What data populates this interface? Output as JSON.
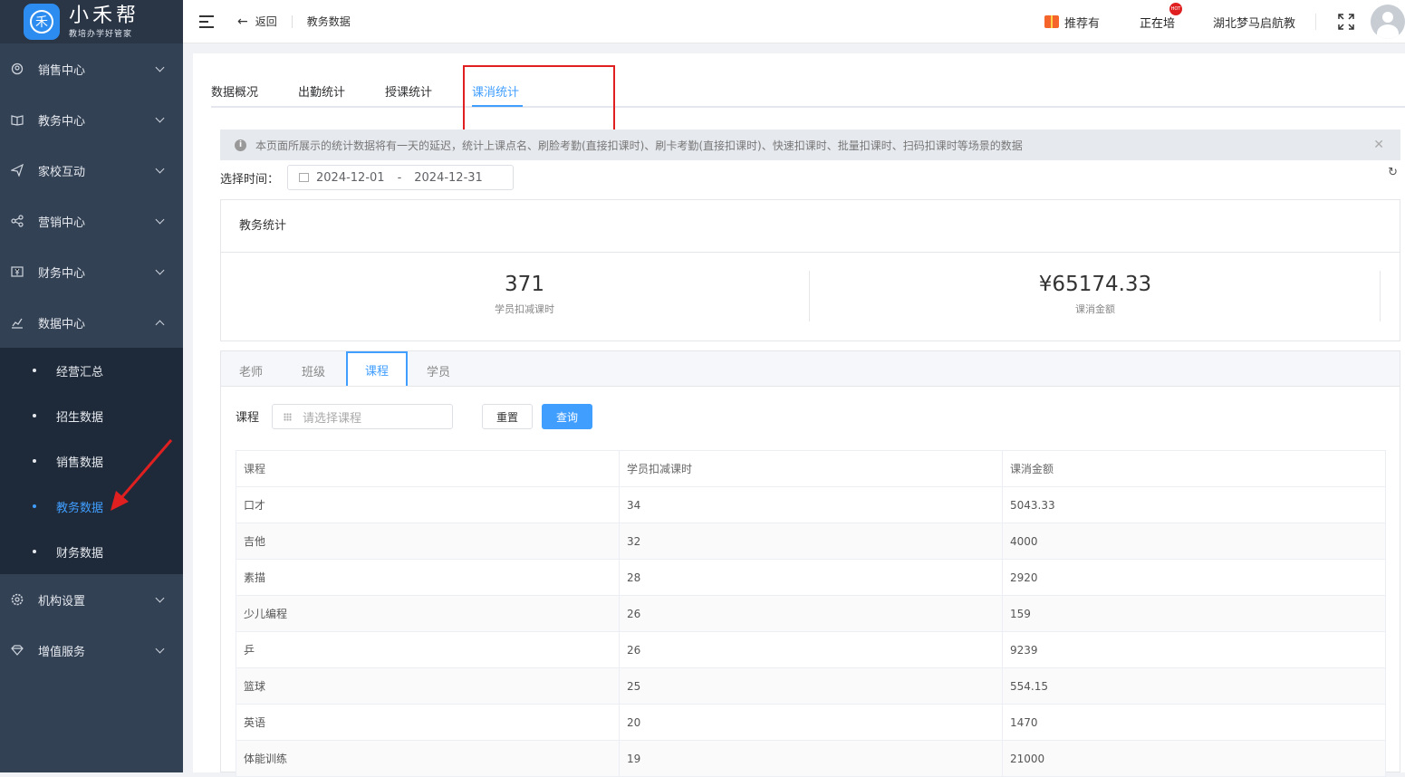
{
  "brand": {
    "name": "小禾帮",
    "slogan": "教培办学好管家",
    "icon_glyph": "禾"
  },
  "sidebar": {
    "items": [
      {
        "label": "销售中心"
      },
      {
        "label": "教务中心"
      },
      {
        "label": "家校互动"
      },
      {
        "label": "营销中心"
      },
      {
        "label": "财务中心"
      },
      {
        "label": "数据中心"
      }
    ],
    "data_sub": [
      {
        "label": "经营汇总"
      },
      {
        "label": "招生数据"
      },
      {
        "label": "销售数据"
      },
      {
        "label": "教务数据"
      },
      {
        "label": "财务数据"
      }
    ],
    "bottom_items": [
      {
        "label": "机构设置"
      },
      {
        "label": "增值服务"
      }
    ]
  },
  "header": {
    "back": "返回",
    "crumb": "教务数据",
    "recommend": "推荐有",
    "hiring": "正在培",
    "hot_badge": "HOT",
    "org": "湖北梦马启航教"
  },
  "tabs": [
    {
      "label": "数据概况"
    },
    {
      "label": "出勤统计"
    },
    {
      "label": "授课统计"
    },
    {
      "label": "课消统计"
    }
  ],
  "notice": "本页面所展示的统计数据将有一天的延迟，统计上课点名、刷脸考勤(直接扣课时)、刷卡考勤(直接扣课时)、快速扣课时、批量扣课时、扫码扣课时等场景的数据",
  "date": {
    "label": "选择时间：",
    "start": "2024-12-01",
    "sep": "-",
    "end": "2024-12-31"
  },
  "stats": {
    "title": "教务统计",
    "hours": {
      "value": "371",
      "label": "学员扣减课时"
    },
    "amount": {
      "value": "¥65174.33",
      "label": "课消金额"
    }
  },
  "sub_tabs": [
    {
      "label": "老师"
    },
    {
      "label": "班级"
    },
    {
      "label": "课程"
    },
    {
      "label": "学员"
    }
  ],
  "filter": {
    "label": "课程",
    "placeholder": "请选择课程",
    "reset": "重置",
    "query": "查询"
  },
  "table": {
    "headers": [
      "课程",
      "学员扣减课时",
      "课消金额"
    ],
    "rows": [
      [
        "口才",
        "34",
        "5043.33"
      ],
      [
        "吉他",
        "32",
        "4000"
      ],
      [
        "素描",
        "28",
        "2920"
      ],
      [
        "少儿编程",
        "26",
        "159"
      ],
      [
        "乒",
        "26",
        "9239"
      ],
      [
        "篮球",
        "25",
        "554.15"
      ],
      [
        "英语",
        "20",
        "1470"
      ],
      [
        "体能训练",
        "19",
        "21000"
      ]
    ]
  },
  "colors": {
    "accent": "#409eff",
    "sidebar": "#334155",
    "highlight_box": "#e02020"
  }
}
